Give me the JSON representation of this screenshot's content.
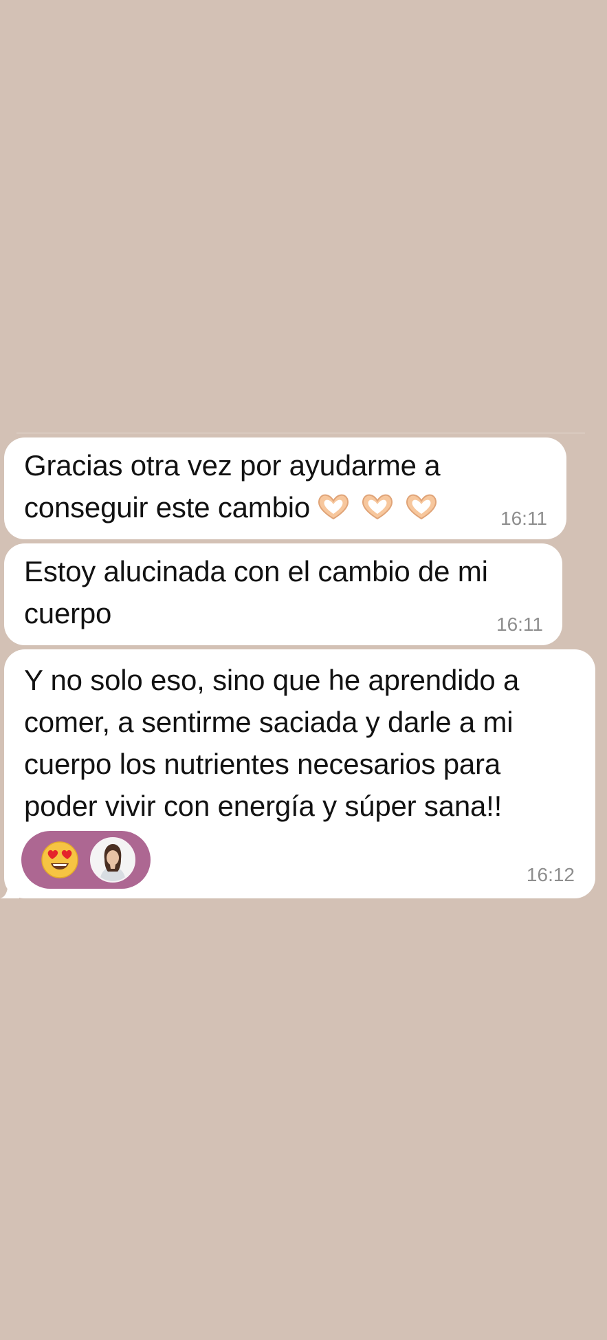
{
  "messages": [
    {
      "lines": [
        "Gracias otra vez por ayudarme a",
        "conseguir este cambio"
      ],
      "emoji": "heart-hands-emoji x3",
      "time": "16:11"
    },
    {
      "lines": [
        "Estoy alucinada con el cambio de mi",
        "cuerpo"
      ],
      "time": "16:11"
    },
    {
      "lines": [
        "Y no solo eso, sino que he aprendido a",
        "comer, a sentirme saciada y darle a mi",
        "cuerpo los nutrientes necesarios para",
        "poder vivir con energía y súper sana!!"
      ],
      "time": "16:12",
      "reactions": [
        "heart-eyes-emoji",
        "user-avatar"
      ]
    }
  ],
  "colors": {
    "background": "#d3c1b5",
    "bubble": "#ffffff",
    "reaction_pill": "#ad6792",
    "timestamp": "#8e8e8e"
  }
}
